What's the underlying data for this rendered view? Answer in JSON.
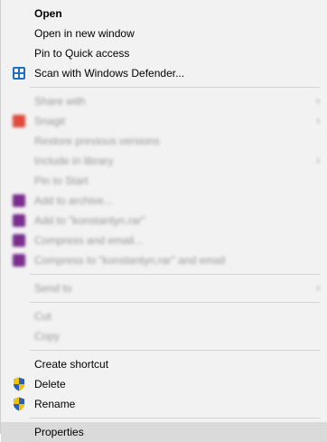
{
  "menu": {
    "open": "Open",
    "open_new_window": "Open in new window",
    "pin_quick_access": "Pin to Quick access",
    "scan_defender": "Scan with Windows Defender...",
    "share_with": "Share with",
    "snagit": "Snagit",
    "restore_versions": "Restore previous versions",
    "include_library": "Include in library",
    "pin_start": "Pin to Start",
    "add_archive": "Add to archive...",
    "add_rar": "Add to \"konstantyn.rar\"",
    "compress_email": "Compress and email...",
    "compress_rar_email": "Compress to \"konstantyn.rar\" and email",
    "send_to": "Send to",
    "cut": "Cut",
    "copy": "Copy",
    "create_shortcut": "Create shortcut",
    "delete": "Delete",
    "rename": "Rename",
    "properties": "Properties",
    "submenu_arrow": "›"
  },
  "colors": {
    "menu_bg": "#f2f2f2",
    "highlight": "#dadada",
    "defender_blue": "#1c6fc6",
    "shield_blue": "#2b5fb3",
    "shield_yellow": "#f2c200",
    "winrar_purple": "#7a2e8e",
    "snagit_red": "#e04a3c"
  }
}
